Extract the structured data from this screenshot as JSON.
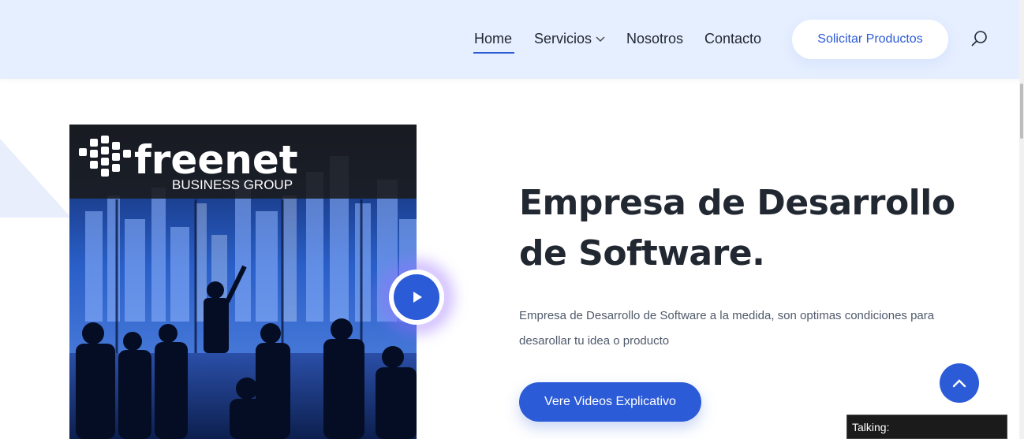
{
  "header": {
    "nav": {
      "home": "Home",
      "services": "Servicios",
      "about": "Nosotros",
      "contact": "Contacto"
    },
    "cta_label": "Solicitar Productos",
    "search_icon": "search-icon"
  },
  "hero": {
    "logo": {
      "brand": "freenet",
      "tagline": "BUSINESS GROUP"
    },
    "title": "Empresa de Desarrollo de Software.",
    "description": "Empresa de Desarrollo de Software a la medida, son optimas condiciones para desarollar tu idea o producto",
    "cta_label": "Vere Videos Explicativo",
    "play_icon": "play-icon"
  },
  "widgets": {
    "back_to_top_icon": "chevron-up-icon",
    "talking_label": "Talking:"
  },
  "colors": {
    "accent": "#2c5bd8",
    "header_bg": "#e6efff",
    "text_dark": "#222831"
  }
}
